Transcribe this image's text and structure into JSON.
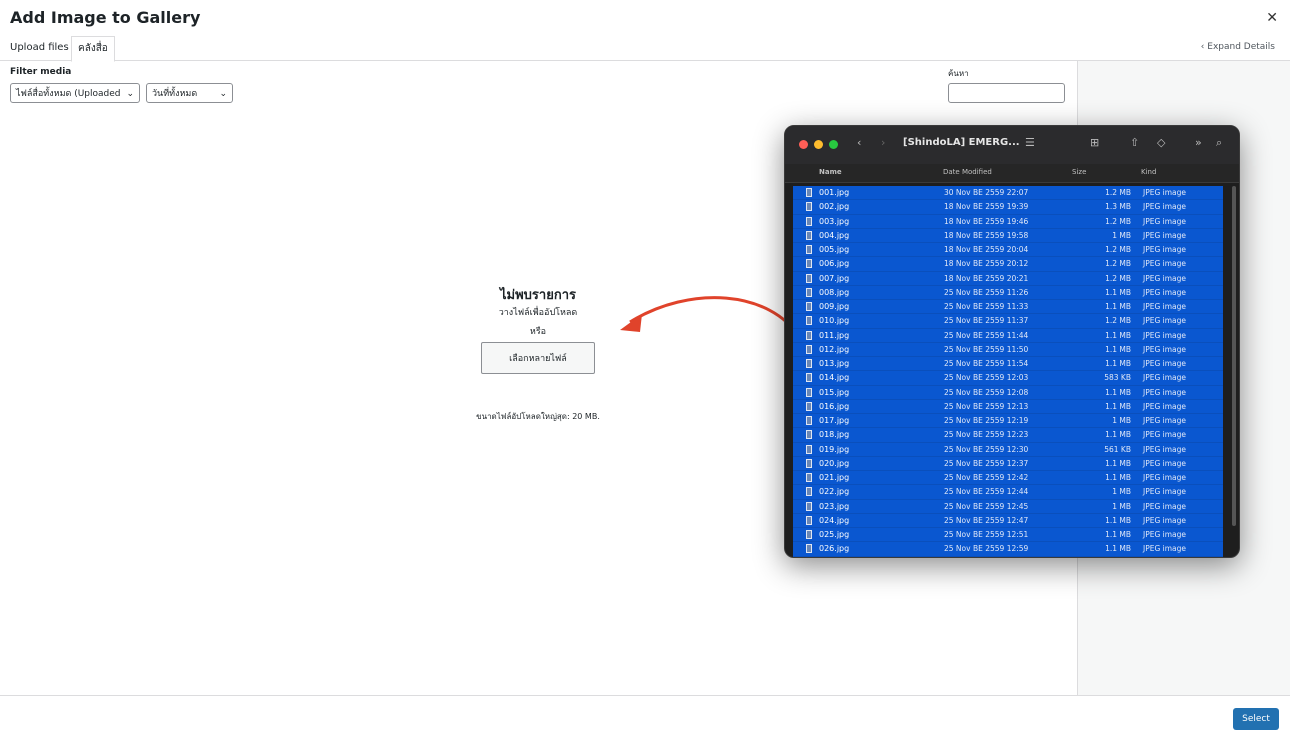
{
  "modal": {
    "title": "Add Image to Gallery",
    "close_glyph": "✕",
    "tabs": [
      "Upload files",
      "คลังสื่อ"
    ],
    "expand_label": "Expand Details",
    "filter_label": "Filter media",
    "type_filter": "ไฟล์สื่อทั้งหมด (Uploaded",
    "date_filter": "วันที่ทั้งหมด",
    "search_label": "ค้นหา",
    "empty_title": "ไม่พบรายการ",
    "drop_text": "วางไฟล์เพื่ออัปโหลด",
    "or_text": "หรือ",
    "select_files_label": "เลือกหลายไฟล์",
    "max_size": "ขนาดไฟล์อัปโหลดใหญ่สุด: 20 MB.",
    "select_button": "Select"
  },
  "finder": {
    "title": "[ShindoLA] EMERG...",
    "columns": [
      "Name",
      "Date Modified",
      "Size",
      "Kind"
    ],
    "files": [
      {
        "name": "001.jpg",
        "date": "30 Nov BE 2559 22:07",
        "size": "1.2 MB",
        "kind": "JPEG image"
      },
      {
        "name": "002.jpg",
        "date": "18 Nov BE 2559 19:39",
        "size": "1.3 MB",
        "kind": "JPEG image"
      },
      {
        "name": "003.jpg",
        "date": "18 Nov BE 2559 19:46",
        "size": "1.2 MB",
        "kind": "JPEG image"
      },
      {
        "name": "004.jpg",
        "date": "18 Nov BE 2559 19:58",
        "size": "1 MB",
        "kind": "JPEG image"
      },
      {
        "name": "005.jpg",
        "date": "18 Nov BE 2559 20:04",
        "size": "1.2 MB",
        "kind": "JPEG image"
      },
      {
        "name": "006.jpg",
        "date": "18 Nov BE 2559 20:12",
        "size": "1.2 MB",
        "kind": "JPEG image"
      },
      {
        "name": "007.jpg",
        "date": "18 Nov BE 2559 20:21",
        "size": "1.2 MB",
        "kind": "JPEG image"
      },
      {
        "name": "008.jpg",
        "date": "25 Nov BE 2559 11:26",
        "size": "1.1 MB",
        "kind": "JPEG image"
      },
      {
        "name": "009.jpg",
        "date": "25 Nov BE 2559 11:33",
        "size": "1.1 MB",
        "kind": "JPEG image"
      },
      {
        "name": "010.jpg",
        "date": "25 Nov BE 2559 11:37",
        "size": "1.2 MB",
        "kind": "JPEG image"
      },
      {
        "name": "011.jpg",
        "date": "25 Nov BE 2559 11:44",
        "size": "1.1 MB",
        "kind": "JPEG image"
      },
      {
        "name": "012.jpg",
        "date": "25 Nov BE 2559 11:50",
        "size": "1.1 MB",
        "kind": "JPEG image"
      },
      {
        "name": "013.jpg",
        "date": "25 Nov BE 2559 11:54",
        "size": "1.1 MB",
        "kind": "JPEG image"
      },
      {
        "name": "014.jpg",
        "date": "25 Nov BE 2559 12:03",
        "size": "583 KB",
        "kind": "JPEG image"
      },
      {
        "name": "015.jpg",
        "date": "25 Nov BE 2559 12:08",
        "size": "1.1 MB",
        "kind": "JPEG image"
      },
      {
        "name": "016.jpg",
        "date": "25 Nov BE 2559 12:13",
        "size": "1.1 MB",
        "kind": "JPEG image"
      },
      {
        "name": "017.jpg",
        "date": "25 Nov BE 2559 12:19",
        "size": "1 MB",
        "kind": "JPEG image"
      },
      {
        "name": "018.jpg",
        "date": "25 Nov BE 2559 12:23",
        "size": "1.1 MB",
        "kind": "JPEG image"
      },
      {
        "name": "019.jpg",
        "date": "25 Nov BE 2559 12:30",
        "size": "561 KB",
        "kind": "JPEG image"
      },
      {
        "name": "020.jpg",
        "date": "25 Nov BE 2559 12:37",
        "size": "1.1 MB",
        "kind": "JPEG image"
      },
      {
        "name": "021.jpg",
        "date": "25 Nov BE 2559 12:42",
        "size": "1.1 MB",
        "kind": "JPEG image"
      },
      {
        "name": "022.jpg",
        "date": "25 Nov BE 2559 12:44",
        "size": "1 MB",
        "kind": "JPEG image"
      },
      {
        "name": "023.jpg",
        "date": "25 Nov BE 2559 12:45",
        "size": "1 MB",
        "kind": "JPEG image"
      },
      {
        "name": "024.jpg",
        "date": "25 Nov BE 2559 12:47",
        "size": "1.1 MB",
        "kind": "JPEG image"
      },
      {
        "name": "025.jpg",
        "date": "25 Nov BE 2559 12:51",
        "size": "1.1 MB",
        "kind": "JPEG image"
      },
      {
        "name": "026.jpg",
        "date": "25 Nov BE 2559 12:59",
        "size": "1.1 MB",
        "kind": "JPEG image"
      }
    ]
  },
  "colors": {
    "accent": "#2271b1",
    "selection": "#0a57d0",
    "arrow": "#e0432b"
  }
}
